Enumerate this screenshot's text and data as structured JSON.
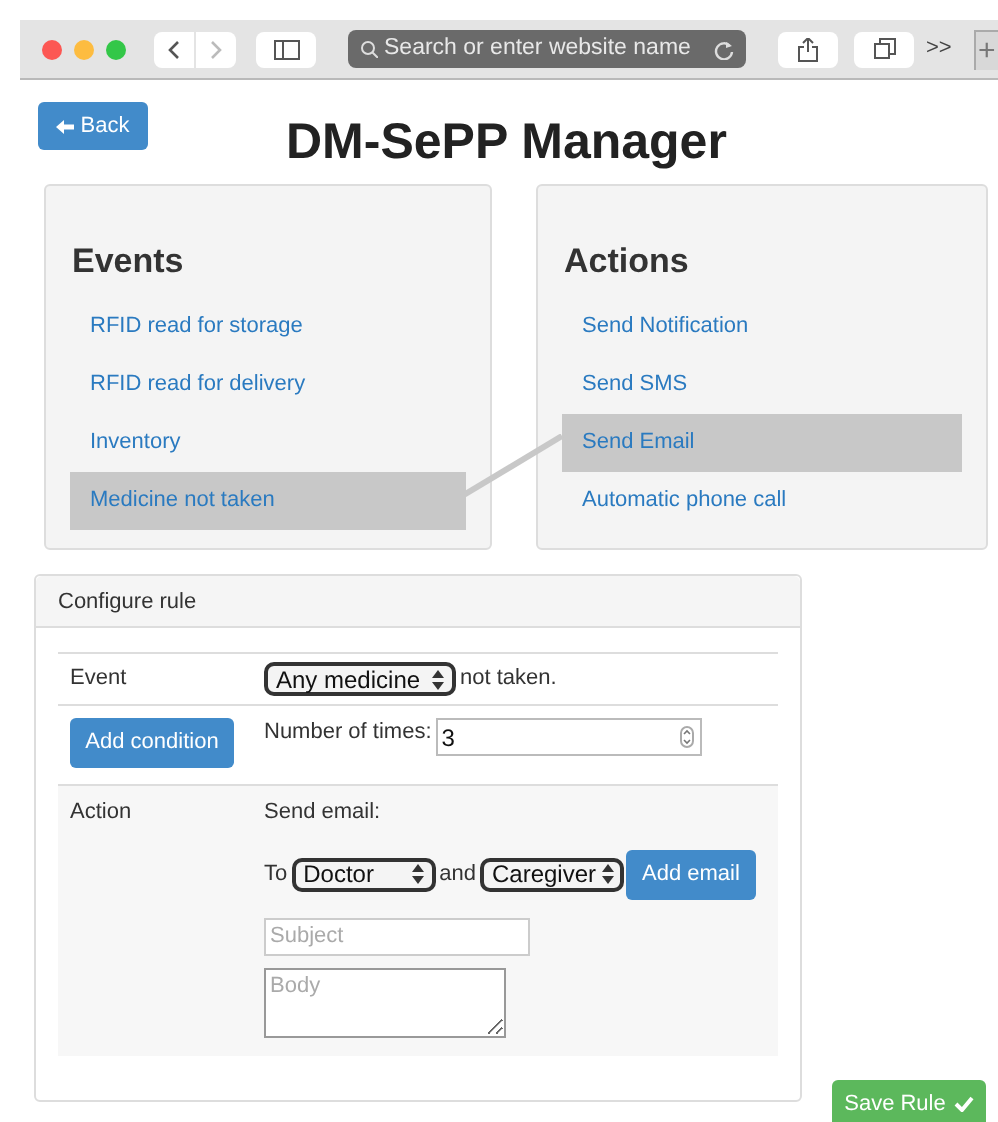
{
  "browser": {
    "address_placeholder": "Search or enter website name",
    "overflow": ">>",
    "new_tab": "+"
  },
  "back_button": "Back",
  "title": "DM-SePP Manager",
  "events": {
    "heading": "Events",
    "items": [
      {
        "label": "RFID read for storage",
        "selected": false
      },
      {
        "label": "RFID read for delivery",
        "selected": false
      },
      {
        "label": "Inventory",
        "selected": false
      },
      {
        "label": "Medicine not taken",
        "selected": true
      }
    ]
  },
  "actions": {
    "heading": "Actions",
    "items": [
      {
        "label": "Send Notification",
        "selected": false
      },
      {
        "label": "Send SMS",
        "selected": false
      },
      {
        "label": "Send Email",
        "selected": true
      },
      {
        "label": "Automatic phone call",
        "selected": false
      }
    ]
  },
  "configure_rule": {
    "heading": "Configure rule",
    "event_label": "Event",
    "medicine_select": "Any medicine",
    "event_suffix": "not taken.",
    "add_condition": "Add condition",
    "times_label": "Number of times:",
    "times_value": "3",
    "action_label": "Action",
    "action_text": "Send email:",
    "to_label": "To",
    "recipient_1": "Doctor",
    "and_label": "and",
    "recipient_2": "Caregiver",
    "add_email": "Add email",
    "subject_placeholder": "Subject",
    "body_placeholder": "Body"
  },
  "save_button": "Save Rule"
}
